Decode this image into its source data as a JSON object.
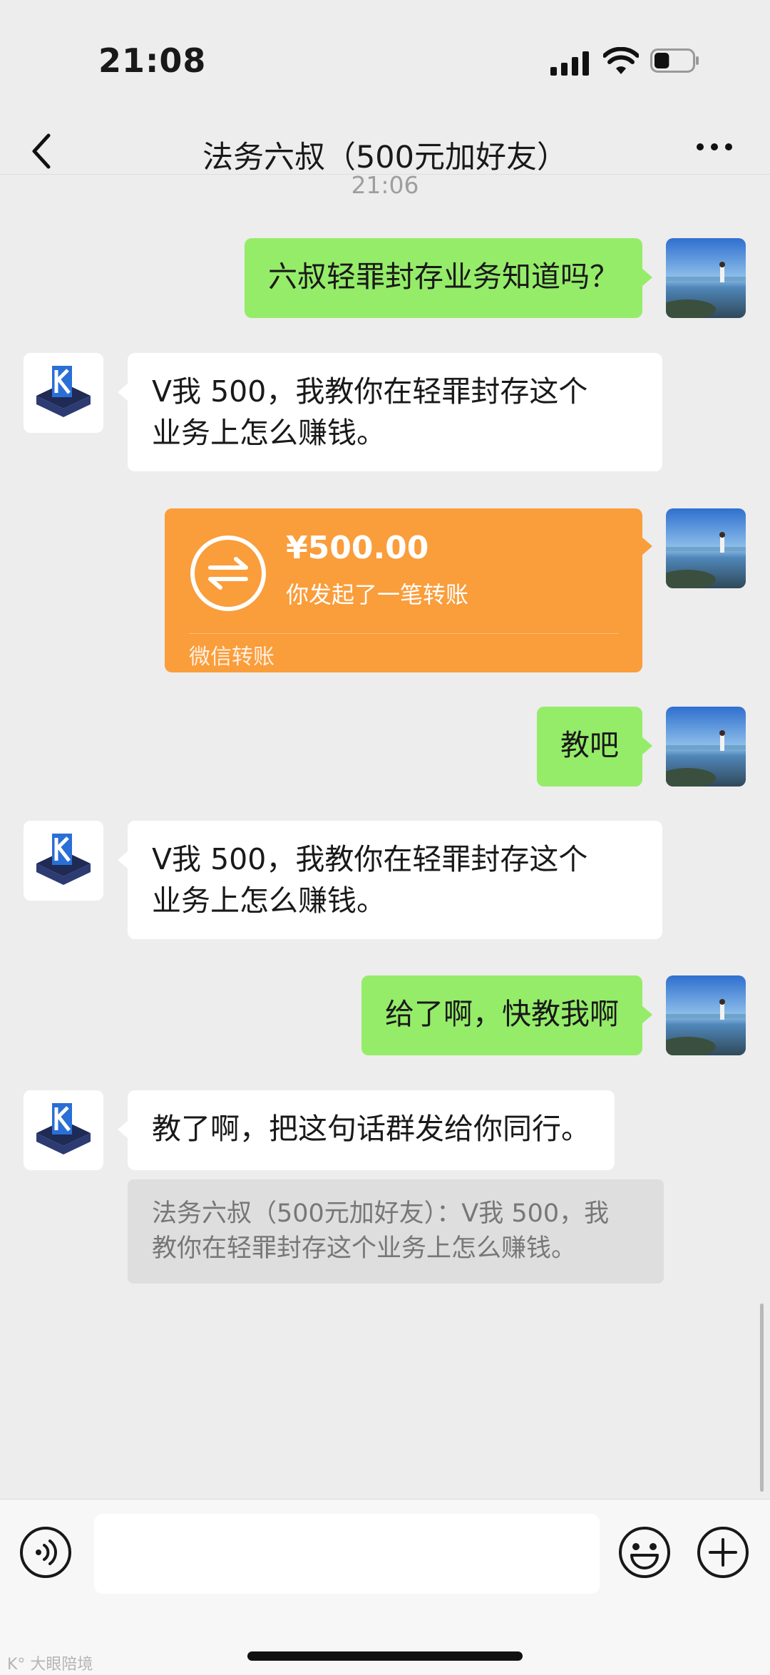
{
  "status_bar": {
    "time": "21:08",
    "battery_level": 0.4
  },
  "header": {
    "title": "法务六叔（500元加好友）",
    "back_icon": "chevron-left-icon",
    "more_icon": "more-dots-icon"
  },
  "timestamp": "21:06",
  "messages": [
    {
      "side": "me",
      "type": "text",
      "text": "六叔轻罪封存业务知道吗？"
    },
    {
      "side": "them",
      "type": "text",
      "lines": [
        "V我 500，我教你在轻罪封存这个",
        "业务上怎么赚钱。"
      ]
    },
    {
      "side": "me",
      "type": "transfer",
      "amount": "¥500.00",
      "subtitle": "你发起了一笔转账",
      "footer": "微信转账"
    },
    {
      "side": "me",
      "type": "text",
      "text": "教吧"
    },
    {
      "side": "them",
      "type": "text",
      "lines": [
        "V我 500，我教你在轻罪封存这个",
        "业务上怎么赚钱。"
      ]
    },
    {
      "side": "me",
      "type": "text",
      "text": "给了啊，快教我啊"
    },
    {
      "side": "them",
      "type": "text",
      "text": "教了啊，把这句话群发给你同行。"
    }
  ],
  "quote": {
    "lines": [
      "法务六叔（500元加好友）：V我 500，我",
      "教你在轻罪封存这个业务上怎么赚钱。"
    ]
  },
  "input_bar": {
    "voice_icon": "voice-icon",
    "emoji_icon": "emoji-icon",
    "plus_icon": "plus-icon",
    "value": ""
  },
  "watermark": "K° 大眼陪境",
  "colors": {
    "background": "#ededed",
    "my_bubble": "#95ec69",
    "their_bubble": "#ffffff",
    "transfer": "#fa9d3b"
  }
}
